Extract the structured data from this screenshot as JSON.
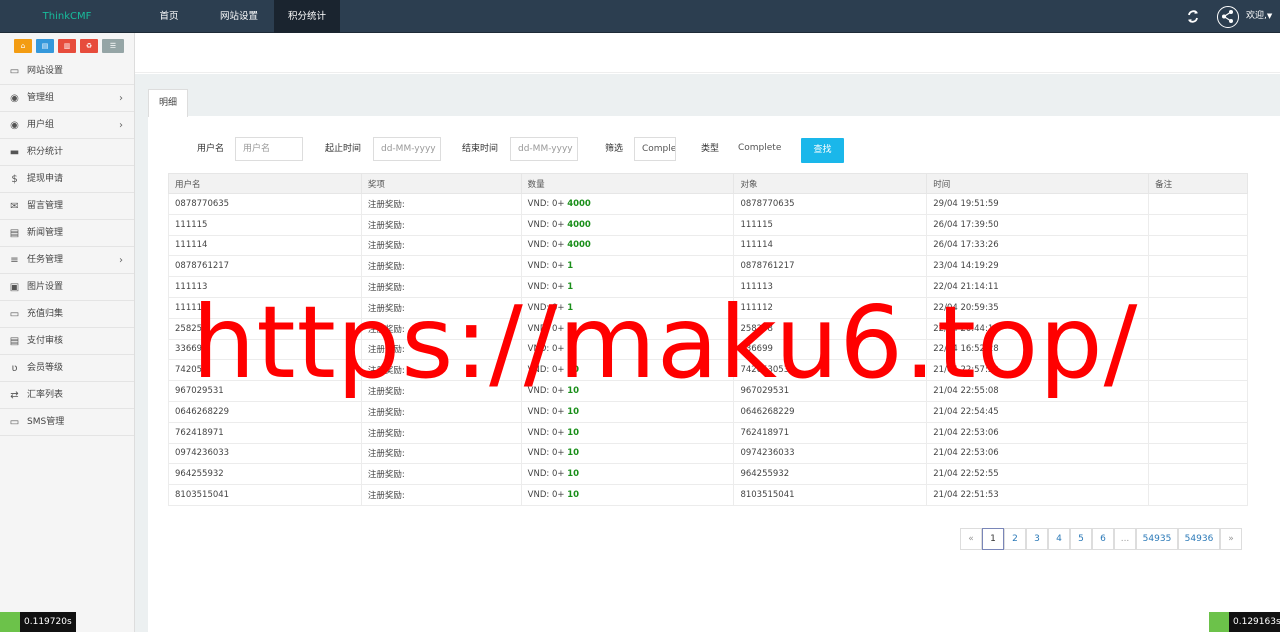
{
  "navbar": {
    "brand": "ThinkCMF",
    "items": [
      {
        "label": "首页"
      },
      {
        "label": "网站设置"
      },
      {
        "label": "积分统计"
      }
    ],
    "refresh_icon": "refresh-icon",
    "user_label": "欢迎,"
  },
  "sidebar": {
    "shortcuts": [
      {
        "icon": "home-icon",
        "color": "#f39c12"
      },
      {
        "icon": "file-icon",
        "color": "#3498db"
      },
      {
        "icon": "trash-icon",
        "color": "#e74c3c"
      },
      {
        "icon": "recycle-icon",
        "color": "#e74c3c"
      },
      {
        "icon": "list-icon",
        "color": "#95a5a6"
      }
    ],
    "items": [
      {
        "label": "网站设置",
        "icon": "monitor-icon",
        "chevron": false
      },
      {
        "label": "管理组",
        "icon": "user-circle-icon",
        "chevron": true
      },
      {
        "label": "用户组",
        "icon": "user-circle-icon",
        "chevron": true
      },
      {
        "label": "积分统计",
        "icon": "visa-icon",
        "chevron": false
      },
      {
        "label": "提现申请",
        "icon": "dollar-icon",
        "chevron": false
      },
      {
        "label": "留言管理",
        "icon": "envelope-icon",
        "chevron": false
      },
      {
        "label": "新闻管理",
        "icon": "newspaper-icon",
        "chevron": false
      },
      {
        "label": "任务管理",
        "icon": "server-icon",
        "chevron": true
      },
      {
        "label": "图片设置",
        "icon": "image-icon",
        "chevron": false
      },
      {
        "label": "充值归集",
        "icon": "money-icon",
        "chevron": false
      },
      {
        "label": "支付审核",
        "icon": "id-card-icon",
        "chevron": false
      },
      {
        "label": "会员等级",
        "icon": "vine-icon",
        "chevron": false
      },
      {
        "label": "汇率列表",
        "icon": "exchange-icon",
        "chevron": false
      },
      {
        "label": "SMS管理",
        "icon": "monitor-icon",
        "chevron": false
      }
    ]
  },
  "tab": {
    "label": "明细"
  },
  "filters": {
    "username_label": "用户名",
    "username_placeholder": "用户名",
    "start_label": "起止时间",
    "start_placeholder": "dd-MM-yyyy",
    "end_label": "结束时间",
    "end_placeholder": "dd-MM-yyyy",
    "filter_label": "筛选",
    "filter_value": "Comple",
    "type_label": "类型",
    "type_value": "Complete",
    "search_button": "查找"
  },
  "table": {
    "headers": [
      "用户名",
      "奖项",
      "数量",
      "对象",
      "时间",
      "备注"
    ],
    "rows": [
      {
        "user": "0878770635",
        "award": "注册奖励:",
        "qty_prefix": "VND: 0+",
        "qty": "4000",
        "target": "0878770635",
        "time": "29/04 19:51:59",
        "note": ""
      },
      {
        "user": "111115",
        "award": "注册奖励:",
        "qty_prefix": "VND: 0+",
        "qty": "4000",
        "target": "111115",
        "time": "26/04 17:39:50",
        "note": ""
      },
      {
        "user": "111114",
        "award": "注册奖励:",
        "qty_prefix": "VND: 0+",
        "qty": "4000",
        "target": "111114",
        "time": "26/04 17:33:26",
        "note": ""
      },
      {
        "user": "0878761217",
        "award": "注册奖励:",
        "qty_prefix": "VND: 0+",
        "qty": "1",
        "target": "0878761217",
        "time": "23/04 14:19:29",
        "note": ""
      },
      {
        "user": "111113",
        "award": "注册奖励:",
        "qty_prefix": "VND: 0+",
        "qty": "1",
        "target": "111113",
        "time": "22/04 21:14:11",
        "note": ""
      },
      {
        "user": "111112",
        "award": "注册奖励:",
        "qty_prefix": "VND: 0+",
        "qty": "1",
        "target": "111112",
        "time": "22/04 20:59:35",
        "note": ""
      },
      {
        "user": "25825",
        "award": "注册奖励:",
        "qty_prefix": "VND: 0+",
        "qty": "1",
        "target": "258258",
        "time": "22/04 20:44:15",
        "note": ""
      },
      {
        "user": "33669",
        "award": "注册奖励:",
        "qty_prefix": "VND: 0+",
        "qty": "1",
        "target": "336699",
        "time": "22/04 16:52:28",
        "note": ""
      },
      {
        "user": "742053",
        "award": "注册奖励:",
        "qty_prefix": "VND: 0+",
        "qty": "10",
        "target": "742053053",
        "time": "21/04 22:57:59",
        "note": ""
      },
      {
        "user": "967029531",
        "award": "注册奖励:",
        "qty_prefix": "VND: 0+",
        "qty": "10",
        "target": "967029531",
        "time": "21/04 22:55:08",
        "note": ""
      },
      {
        "user": "0646268229",
        "award": "注册奖励:",
        "qty_prefix": "VND: 0+",
        "qty": "10",
        "target": "0646268229",
        "time": "21/04 22:54:45",
        "note": ""
      },
      {
        "user": "762418971",
        "award": "注册奖励:",
        "qty_prefix": "VND: 0+",
        "qty": "10",
        "target": "762418971",
        "time": "21/04 22:53:06",
        "note": ""
      },
      {
        "user": "0974236033",
        "award": "注册奖励:",
        "qty_prefix": "VND: 0+",
        "qty": "10",
        "target": "0974236033",
        "time": "21/04 22:53:06",
        "note": ""
      },
      {
        "user": "964255932",
        "award": "注册奖励:",
        "qty_prefix": "VND: 0+",
        "qty": "10",
        "target": "964255932",
        "time": "21/04 22:52:55",
        "note": ""
      },
      {
        "user": "8103515041",
        "award": "注册奖励:",
        "qty_prefix": "VND: 0+",
        "qty": "10",
        "target": "8103515041",
        "time": "21/04 22:51:53",
        "note": ""
      }
    ]
  },
  "pagination": {
    "prev": "«",
    "pages": [
      "1",
      "2",
      "3",
      "4",
      "5",
      "6",
      "...",
      "54935",
      "54936"
    ],
    "current": "1",
    "next": "»"
  },
  "watermark": "https://maku6.top/",
  "timers": {
    "left": "0.119720s",
    "right": "0.129163s"
  },
  "colors": {
    "navbar": "#2c3e50",
    "brand": "#18bc9c",
    "search_button": "#1ab7ea",
    "watermark": "#ff0000",
    "qty": "#1a8f1a"
  }
}
